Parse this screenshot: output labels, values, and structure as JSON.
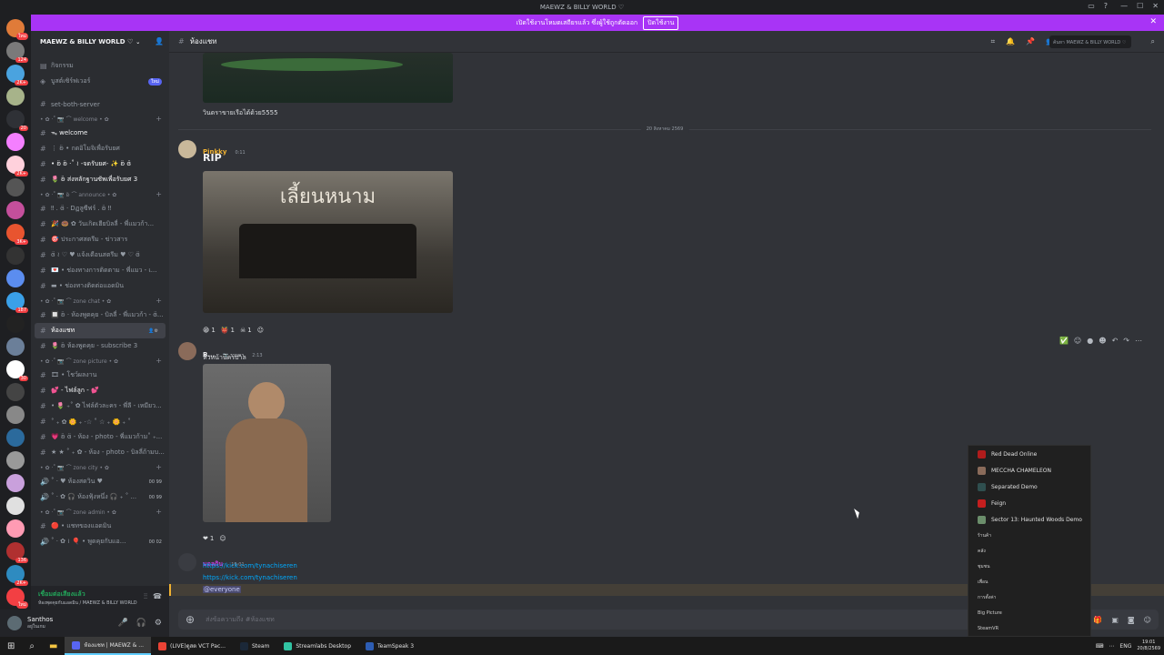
{
  "window": {
    "title": "MAEWZ & BILLY WORLD ♡"
  },
  "banner": {
    "text": "เปิดใช้งานโหมดเสถียรแล้ว ซึ่งผู้ใช้ถูกตัดออก",
    "button": "ปิดใช้งาน"
  },
  "servers": [
    {
      "color": "#e07b39",
      "badge": "ใหม่"
    },
    {
      "color": "#7a7a7a",
      "badge": "124"
    },
    {
      "color": "#4aa3df",
      "badge": "2K+"
    },
    {
      "color": "#a7b38a",
      "badge": ""
    },
    {
      "color": "#2f3136",
      "badge": "20"
    },
    {
      "color": "#f47fff",
      "badge": ""
    },
    {
      "color": "#ffd1dc",
      "badge": "2K+"
    },
    {
      "color": "#555",
      "badge": ""
    },
    {
      "color": "#c44f9b",
      "badge": ""
    },
    {
      "color": "#e8542f",
      "badge": "3K+"
    },
    {
      "color": "#333",
      "badge": ""
    },
    {
      "color": "#5b8def",
      "badge": ""
    },
    {
      "color": "#3aa0e8",
      "badge": "187"
    },
    {
      "color": "#222",
      "badge": ""
    },
    {
      "color": "#6b7f99",
      "badge": ""
    },
    {
      "color": "#fff",
      "badge": "30"
    },
    {
      "color": "#444",
      "badge": ""
    },
    {
      "color": "#888",
      "badge": ""
    },
    {
      "color": "#2b6a9c",
      "badge": ""
    },
    {
      "color": "#999",
      "badge": ""
    },
    {
      "color": "#c9a0dc",
      "badge": ""
    },
    {
      "color": "#e0e0e0",
      "badge": ""
    },
    {
      "color": "#ff9bb3",
      "badge": ""
    },
    {
      "color": "#b03030",
      "badge": "136"
    },
    {
      "color": "#2e8bc0",
      "badge": "2K+"
    },
    {
      "color": "#f23f43",
      "badge": "ใหม่"
    }
  ],
  "sidebar": {
    "server_name": "MAEWZ & BILLY WORLD ♡",
    "activity": "กิจกรรม",
    "boost": "บูสต์เซิร์ฟเวอร์",
    "boost_badge": "ใหม่",
    "channels": [
      {
        "type": "ch",
        "label": "set-both-server"
      },
      {
        "type": "cat",
        "label": "• ✿ ·˚ 📷 ⌒ welcome • ✿"
      },
      {
        "type": "ch",
        "label": "ᯓ welcome",
        "bright": true
      },
      {
        "type": "ch",
        "label": "⋮ ʚ̈ • กดอิโมจิเพื่อรับยศ"
      },
      {
        "type": "ch",
        "label": "• ʚ̈ ʚ̈ ·˚ ≀ -จดรับยศ- ✨ ʚ̈ ɞ̈",
        "bright": true
      },
      {
        "type": "ch",
        "label": "🌷 ʚ̈ ส่งหลักฐานซัพเพื่อรับยศ 3",
        "bright": true
      },
      {
        "type": "cat",
        "label": "• ✿ ·˚ 📷 ʚ̈ ⌒ announce • ✿"
      },
      {
        "type": "ch",
        "label": "‼ . ɞ̈ · Dฏลูซีฟร์ . ʚ̈ ‼"
      },
      {
        "type": "ch",
        "label": "🎉 🍩 ✿ วันเกิดเฮียบิลลี่ - พี่แมวก้า..."
      },
      {
        "type": "ch",
        "label": "🎯 ประกาศสตรีม - ข่าวสาร"
      },
      {
        "type": "ch",
        "label": "ɞ̈ ≀ ♡ ♥ แจ้งเตือนสตรีม ♥ ♡ ɞ̈"
      },
      {
        "type": "ch",
        "label": "💌 • ช่องทางการติดตาม - พี่แมว - เ..."
      },
      {
        "type": "ch",
        "label": "▬ • ช่องทางติดต่อแอดมิน"
      },
      {
        "type": "cat",
        "label": "• ✿ ·˚ 📷 ⌒ zone chat • ✿"
      },
      {
        "type": "ch",
        "label": "🔲 ʚ̈ · ห้องพูดคุย - บิลลี่ - พี่แมวก้า - ɞ̈..."
      },
      {
        "type": "ch",
        "label": "ห้องแชท",
        "selected": true
      },
      {
        "type": "ch",
        "label": "🌷 ʚ̈ ห้องพูดคุย - subscribe 3"
      },
      {
        "type": "cat",
        "label": "• ✿ ·˚ 📷 ⌒ zone picture • ✿"
      },
      {
        "type": "ch",
        "label": "🎞 • โชว์ผลงาน"
      },
      {
        "type": "ch",
        "label": "💕 - ไฟล์ลูก - 💕",
        "bright": true
      },
      {
        "type": "ch",
        "label": "• 🌷 ₊˚ ✿ ไฟล์ตัวละคร - พี่ลี - เหมียว..."
      },
      {
        "type": "ch",
        "label": "˚ ₊ ✿ 🌼 ₊ ·☆ ˚ ☆ ₊ 🌼 ₊ ˚"
      },
      {
        "type": "ch",
        "label": "💗 ʚ̈ ɞ̈ - ห้อง - photo - พี่แมวก้าม˚ ₊..."
      },
      {
        "type": "ch",
        "label": "★ ★ ˚ ₊ ✿ - ห้อง - photo - บิลลี่ถ้ามบ..."
      },
      {
        "type": "cat",
        "label": "• ✿ ·˚ 📷 ⌒ zone city • ✿"
      },
      {
        "type": "voice",
        "label": "˚ · ♥ ห้องสดวิน ♥",
        "count": "00 99"
      },
      {
        "type": "voice",
        "label": "˚ · ✿ 🎧 ห้องฟุ้งหนึ่ง 🎧 ₊ ˚ ...",
        "count": "00 99"
      },
      {
        "type": "cat",
        "label": "• ✿ ·˚ 📷 ⌒ zone admin • ✿"
      },
      {
        "type": "ch",
        "label": "🔴 • แชทของแอดมิน"
      },
      {
        "type": "voice",
        "label": "˚ · ✿ ≀ 🎈 • พูดคุยกับแอ...",
        "count": "00 02"
      }
    ]
  },
  "voice": {
    "status": "เชื่อมต่อเสียงแล้ว",
    "sub": "ห้องพุดคุยกับแอดมิน / MAEWZ & BILLY WORLD"
  },
  "user": {
    "name": "Santhos",
    "status": "อยู่ในเกม"
  },
  "chat_header": {
    "channel": "ห้องแชท",
    "search_placeholder": "ค้นหา MAEWZ & BILLY WORLD ♡"
  },
  "messages": {
    "m0_text": "วินดราขายเรือได้ด้วย5555",
    "divider": "20 สิงหาคม 2569",
    "m1_user": "Pinkky",
    "m1_time": "0:11",
    "m1_text": "RIP",
    "m1_reacts": [
      {
        "emoji": "😁",
        "count": "1"
      },
      {
        "emoji": "👹",
        "count": "1"
      },
      {
        "emoji": "☠",
        "count": "1"
      }
    ],
    "image_title": "เลี้ยนหนาม",
    "m2_user": "B...",
    "m2_tag": "📷 รามคา",
    "m2_time": "2:13",
    "m2_text": "หัวหน้านครบาล",
    "m2_reacts": [
      {
        "emoji": "❤",
        "count": "1"
      }
    ],
    "m3_user": "มอลกิน",
    "m3_time": "19:01",
    "m3_link1": "https://kick.com/tynachiseren",
    "m3_link2": "https://kick.com/tynachiseren",
    "m3_mention": "@everyone",
    "composer_placeholder": "ส่งข้อความถึง #ห้องแชท"
  },
  "jump_list": {
    "recent": [
      {
        "label": "Red Dead Online",
        "color": "#b01c1c"
      },
      {
        "label": "MECCHA CHAMELEON",
        "color": "#8a6b5a"
      },
      {
        "label": "Separated Demo",
        "color": "#2f4f4f"
      },
      {
        "label": "Feign",
        "color": "#c41e1e"
      },
      {
        "label": "Sector 13: Haunted Woods Demo",
        "color": "#6b8e6b"
      }
    ],
    "items": [
      "ร้านค้า",
      "คลัง",
      "ชุมชน",
      "เพื่อน",
      "การตั้งค่า",
      "Big Picture",
      "SteamVR"
    ]
  },
  "taskbar": {
    "apps": [
      "ห้องแชท | MAEWZ & ...",
      "(LIVE)ดูสด VCT Pac...",
      "Steam",
      "Streamlabs Desktop",
      "TeamSpeak 3"
    ],
    "lang": "ENG",
    "time": "19:01",
    "date": "20/8/2569"
  }
}
